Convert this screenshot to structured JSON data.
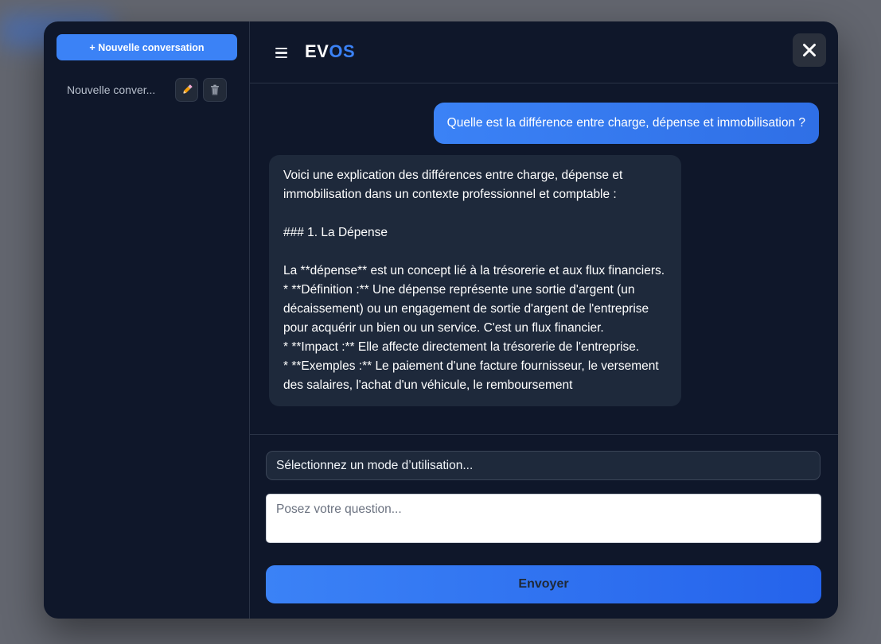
{
  "sidebar": {
    "new_conversation_label": "+ Nouvelle conversation",
    "conversations": [
      {
        "title": "Nouvelle conver...",
        "edit_icon": "pencil-icon",
        "delete_icon": "trash-icon"
      }
    ]
  },
  "header": {
    "menu_icon": "hamburger-icon",
    "brand_ev": "EV",
    "brand_os": "OS",
    "close_icon": "close-icon"
  },
  "chat": {
    "user_message": "Quelle est la différence entre charge, dépense et immobilisation ?",
    "assistant_message": "Voici une explication des différences entre charge, dépense et immobilisation dans un contexte professionnel et comptable :\n\n### 1. La Dépense\n\nLa **dépense** est un concept lié à la trésorerie et aux flux financiers.\n* **Définition :** Une dépense représente une sortie d'argent (un décaissement) ou un engagement de sortie d'argent de l'entreprise pour acquérir un bien ou un service. C'est un flux financier.\n* **Impact :** Elle affecte directement la trésorerie de l'entreprise.\n* **Exemples :** Le paiement d'une facture fournisseur, le versement des salaires, l'achat d'un véhicule, le remboursement"
  },
  "composer": {
    "mode_select_value": "Sélectionnez un mode d’utilisation...",
    "question_placeholder": "Posez votre question...",
    "send_label": "Envoyer"
  },
  "colors": {
    "accent": "#3b82f6",
    "modal_bg": "#0f172a",
    "bubble_bg": "#1e293b"
  }
}
